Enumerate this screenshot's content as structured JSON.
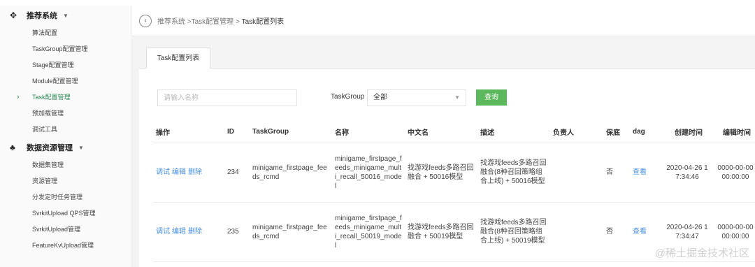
{
  "sidebar": {
    "groups": [
      {
        "label": "推荐系统",
        "icon": "move-cross-icon",
        "items": [
          {
            "label": "算法配置",
            "active": false
          },
          {
            "label": "TaskGroup配置管理",
            "active": false
          },
          {
            "label": "Stage配置管理",
            "active": false
          },
          {
            "label": "Module配置管理",
            "active": false
          },
          {
            "label": "Task配置管理",
            "active": true
          },
          {
            "label": "预加载管理",
            "active": false
          },
          {
            "label": "调试工具",
            "active": false
          }
        ]
      },
      {
        "label": "数据资源管理",
        "icon": "share-nodes-icon",
        "items": [
          {
            "label": "数据集管理",
            "active": false
          },
          {
            "label": "资源管理",
            "active": false
          },
          {
            "label": "分发定时任务管理",
            "active": false
          },
          {
            "label": "SvrkitUpload QPS管理",
            "active": false
          },
          {
            "label": "SvrkitUpload管理",
            "active": false
          },
          {
            "label": "FeatureKvUpload管理",
            "active": false
          }
        ]
      }
    ]
  },
  "breadcrumb": {
    "prefix": "推荐系统 >Task配置管理 > ",
    "current": "Task配置列表"
  },
  "tab": {
    "label": "Task配置列表"
  },
  "filters": {
    "name_placeholder": "请输入名称",
    "taskgroup_label": "TaskGroup",
    "taskgroup_value": "全部",
    "query_label": "查询"
  },
  "table": {
    "headers": [
      "操作",
      "ID",
      "TaskGroup",
      "名称",
      "中文名",
      "描述",
      "负责人",
      "保底",
      "dag",
      "创建时间",
      "编辑时间"
    ],
    "rows": [
      {
        "actions": [
          "调试",
          "编辑",
          "删除"
        ],
        "id": "234",
        "taskgroup": "minigame_firstpage_feeds_rcmd",
        "name": "minigame_firstpage_feeds_minigame_multi_recall_50016_model",
        "cn_name": "找游戏feeds多路召回融合 + 50016模型",
        "desc": "找游戏feeds多路召回融合(8种召回策略组合上线) + 50016模型",
        "owner": "",
        "fallback": "否",
        "dag": "查看",
        "created": "2020-04-26 17:34:46",
        "edited": "0000-00-00 00:00:00"
      },
      {
        "actions": [
          "调试",
          "编辑",
          "删除"
        ],
        "id": "235",
        "taskgroup": "minigame_firstpage_feeds_rcmd",
        "name": "minigame_firstpage_feeds_minigame_multi_recall_50019_model",
        "cn_name": "找游戏feeds多路召回融合 + 50019模型",
        "desc": "找游戏feeds多路召回融合(8种召回策略组合上线) + 50019模型",
        "owner": "",
        "fallback": "否",
        "dag": "查看",
        "created": "2020-04-26 17:34:47",
        "edited": "0000-00-00 00:00:00"
      }
    ]
  },
  "watermark": "@稀土掘金技术社区",
  "colors": {
    "accent_green": "#5cb85c",
    "link_blue": "#4a90e2",
    "active_menu": "#2e8b57"
  }
}
